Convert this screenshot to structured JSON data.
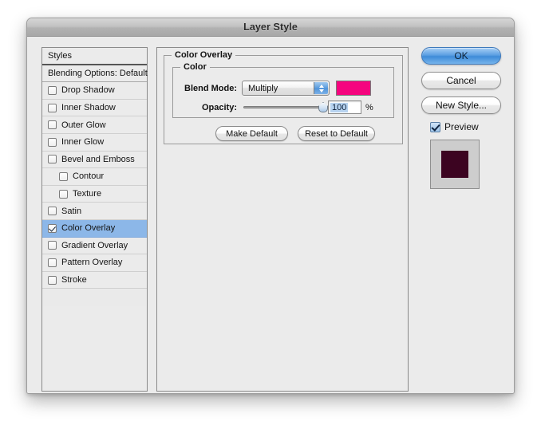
{
  "window": {
    "title": "Layer Style"
  },
  "sidebar": {
    "header": "Styles",
    "items": [
      {
        "label": "Blending Options: Default",
        "type": "plain",
        "checked": false,
        "indented": false,
        "selected": false
      },
      {
        "label": "Drop Shadow",
        "type": "checkbox",
        "checked": false,
        "indented": false,
        "selected": false
      },
      {
        "label": "Inner Shadow",
        "type": "checkbox",
        "checked": false,
        "indented": false,
        "selected": false
      },
      {
        "label": "Outer Glow",
        "type": "checkbox",
        "checked": false,
        "indented": false,
        "selected": false
      },
      {
        "label": "Inner Glow",
        "type": "checkbox",
        "checked": false,
        "indented": false,
        "selected": false
      },
      {
        "label": "Bevel and Emboss",
        "type": "checkbox",
        "checked": false,
        "indented": false,
        "selected": false
      },
      {
        "label": "Contour",
        "type": "checkbox",
        "checked": false,
        "indented": true,
        "selected": false
      },
      {
        "label": "Texture",
        "type": "checkbox",
        "checked": false,
        "indented": true,
        "selected": false
      },
      {
        "label": "Satin",
        "type": "checkbox",
        "checked": false,
        "indented": false,
        "selected": false
      },
      {
        "label": "Color Overlay",
        "type": "checkbox",
        "checked": true,
        "indented": false,
        "selected": true
      },
      {
        "label": "Gradient Overlay",
        "type": "checkbox",
        "checked": false,
        "indented": false,
        "selected": false
      },
      {
        "label": "Pattern Overlay",
        "type": "checkbox",
        "checked": false,
        "indented": false,
        "selected": false
      },
      {
        "label": "Stroke",
        "type": "checkbox",
        "checked": false,
        "indented": false,
        "selected": false
      }
    ]
  },
  "main": {
    "group_title": "Color Overlay",
    "subgroup_title": "Color",
    "blend_mode_label": "Blend Mode:",
    "blend_mode_value": "Multiply",
    "color_swatch_hex": "#F5057F",
    "opacity_label": "Opacity:",
    "opacity_value": "100",
    "opacity_unit": "%",
    "opacity_percent": 100,
    "make_default_label": "Make Default",
    "reset_default_label": "Reset to Default"
  },
  "actions": {
    "ok_label": "OK",
    "cancel_label": "Cancel",
    "new_style_label": "New Style...",
    "preview_label": "Preview",
    "preview_checked": true,
    "preview_swatch_hex": "#3C0421",
    "preview_bg_hex": "#CDCDCD"
  },
  "selection_highlight_hex": "#8CB7E8"
}
